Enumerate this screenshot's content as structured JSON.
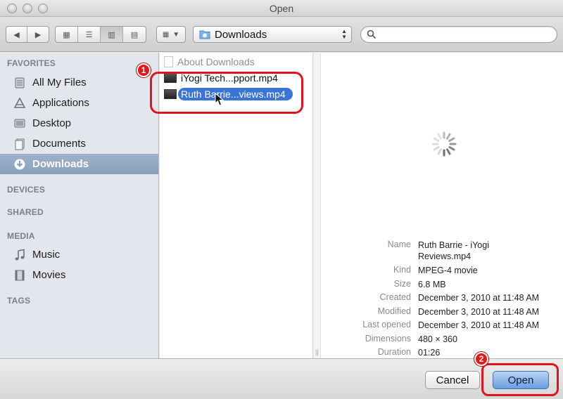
{
  "window": {
    "title": "Open"
  },
  "toolbar": {
    "location": "Downloads",
    "search_placeholder": ""
  },
  "sidebar": {
    "favorites_header": "FAVORITES",
    "favorites": [
      {
        "label": "All My Files",
        "icon": "all-files-icon"
      },
      {
        "label": "Applications",
        "icon": "applications-icon"
      },
      {
        "label": "Desktop",
        "icon": "desktop-icon"
      },
      {
        "label": "Documents",
        "icon": "documents-icon"
      },
      {
        "label": "Downloads",
        "icon": "downloads-icon",
        "selected": true
      }
    ],
    "devices_header": "DEVICES",
    "shared_header": "SHARED",
    "media_header": "MEDIA",
    "media": [
      {
        "label": "Music",
        "icon": "music-icon"
      },
      {
        "label": "Movies",
        "icon": "movies-icon"
      }
    ],
    "tags_header": "TAGS"
  },
  "files": [
    {
      "label": "About Downloads",
      "dimmed": true
    },
    {
      "label": "iYogi Tech...pport.mp4"
    },
    {
      "label": "Ruth Barrie...views.mp4",
      "selected": true
    }
  ],
  "annotations": {
    "badge1": "1",
    "badge2": "2",
    "callout_color": "#e0141a"
  },
  "preview": {
    "name_label": "Name",
    "name_value": "Ruth Barrie - iYogi Reviews.mp4",
    "kind_label": "Kind",
    "kind_value": "MPEG-4 movie",
    "size_label": "Size",
    "size_value": "6.8 MB",
    "created_label": "Created",
    "created_value": "December 3, 2010 at 11:48 AM",
    "modified_label": "Modified",
    "modified_value": "December 3, 2010 at 11:48 AM",
    "last_opened_label": "Last opened",
    "last_opened_value": "December 3, 2010 at 11:48 AM",
    "dimensions_label": "Dimensions",
    "dimensions_value": "480 × 360",
    "duration_label": "Duration",
    "duration_value": "01:26"
  },
  "buttons": {
    "cancel": "Cancel",
    "open": "Open"
  },
  "colors": {
    "selection": "#3875d7",
    "sidebar_selected": "#8aa0bd",
    "accent_red": "#e0141a"
  }
}
